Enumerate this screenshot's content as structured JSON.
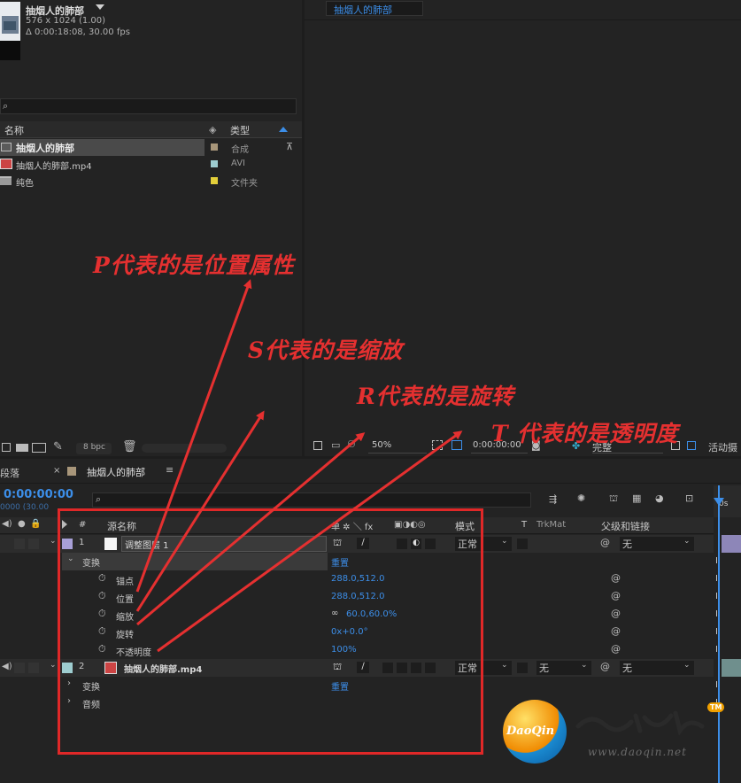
{
  "project": {
    "comp_name": "抽烟人的肺部",
    "comp_dims": "576 x 1024 (1.00)",
    "comp_duration": "Δ 0:00:18:08, 30.00 fps",
    "search_placeholder": "",
    "col_name": "名称",
    "col_type": "类型",
    "items": [
      {
        "name": "抽烟人的肺部",
        "type": "合成",
        "color": "#a8967a",
        "icon": "composition-icon"
      },
      {
        "name": "抽烟人的肺部.mp4",
        "type": "AVI",
        "color": "#9ecdd0",
        "icon": "video-file-icon"
      },
      {
        "name": "纯色",
        "type": "文件夹",
        "color": "#e3cf3a",
        "icon": "folder-icon"
      }
    ],
    "bpc": "8 bpc"
  },
  "viewer": {
    "tab": "抽烟人的肺部",
    "zoom": "50%",
    "timecode": "0:00:00:00",
    "resolution": "完整",
    "active_camera": "活动摄"
  },
  "timeline": {
    "left_tab": "段落",
    "comp_tab": "抽烟人的肺部",
    "current_time": "0:00:00:00",
    "frame_info": "0000 (30.00",
    "search_placeholder": "",
    "ruler_label": "0s",
    "headers": {
      "number": "#",
      "source_name": "源名称",
      "switches": "单 ✲ ＼ fx",
      "mode": "模式",
      "t": "T",
      "trkmat": "TrkMat",
      "parent": "父级和链接"
    },
    "layer1": {
      "num": "1",
      "name": "调整图层 1",
      "mode": "正常",
      "parent": "无"
    },
    "transform_label": "变换",
    "transform_reset": "重置",
    "props": [
      {
        "name": "锚点",
        "value": "288.0,512.0"
      },
      {
        "name": "位置",
        "value": "288.0,512.0"
      },
      {
        "name": "缩放",
        "value": "60.0,60.0%"
      },
      {
        "name": "旋转",
        "value": "0x+0.0°"
      },
      {
        "name": "不透明度",
        "value": "100%"
      }
    ],
    "layer2": {
      "num": "2",
      "name": "抽烟人的肺部.mp4",
      "mode": "正常",
      "trkmat": "无",
      "parent": "无"
    },
    "layer2_transform": "变换",
    "layer2_reset": "重置",
    "layer2_audio": "音频"
  },
  "annotations": {
    "p": "P代表的是位置属性",
    "s": "S代表的是缩放",
    "r": "R代表的是旋转",
    "t": "T 代表的是透明度"
  },
  "watermark": {
    "badge": "DaoQin",
    "site": "www.daoqin.net",
    "tm": "TM"
  }
}
